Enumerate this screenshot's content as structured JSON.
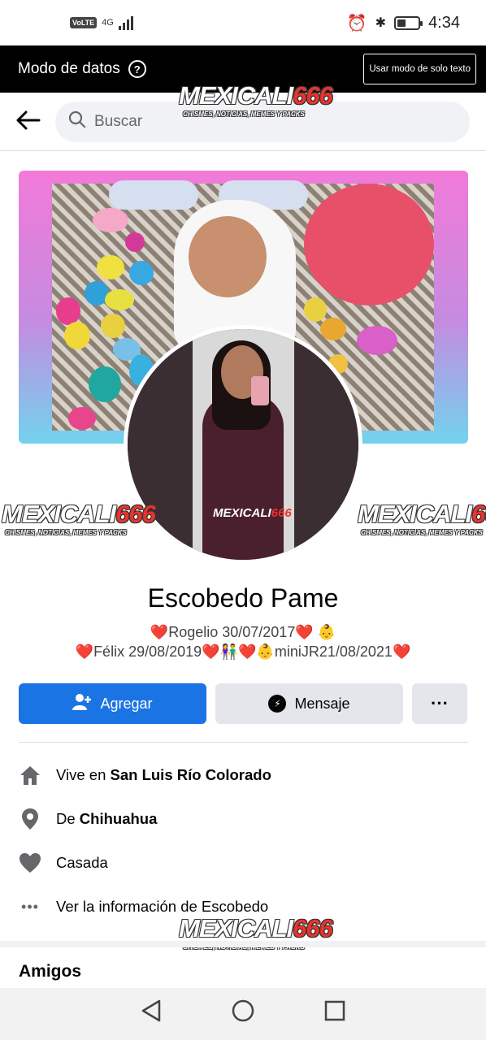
{
  "status_bar": {
    "volte": "VoLTE",
    "network": "4G",
    "time": "4:34",
    "battery_level": 0.4
  },
  "data_mode": {
    "title": "Modo de datos",
    "help_glyph": "?",
    "text_only_button": "Usar modo de solo texto"
  },
  "search": {
    "placeholder": "Buscar"
  },
  "watermark": {
    "text": "MEXICALI",
    "number": "666",
    "tagline": "CHISMES, NOTICIAS, MEMES Y PACKS"
  },
  "profile": {
    "name": "Escobedo Pame",
    "bio_line1_name": "Rogelio 30/07/2017",
    "bio_line1_emoji": "👶",
    "bio_line2_a": "Félix 29/08/2019",
    "bio_line2_emoji_a": "👫",
    "bio_line2_emoji_b": "👶",
    "bio_line2_b": "miniJR21/08/2021"
  },
  "actions": {
    "add_label": "Agregar",
    "message_label": "Mensaje",
    "more_label": "···"
  },
  "info": {
    "lives_prefix": "Vive en",
    "lives_place": "San Luis Río Colorado",
    "from_prefix": "De",
    "from_place": "Chihuahua",
    "relationship": "Casada",
    "see_info": "Ver la información de Escobedo"
  },
  "friends": {
    "title": "Amigos"
  },
  "colors": {
    "facebook_blue": "#1b74e4",
    "heart_red": "#e41e3f",
    "button_gray": "#e4e6eb"
  }
}
